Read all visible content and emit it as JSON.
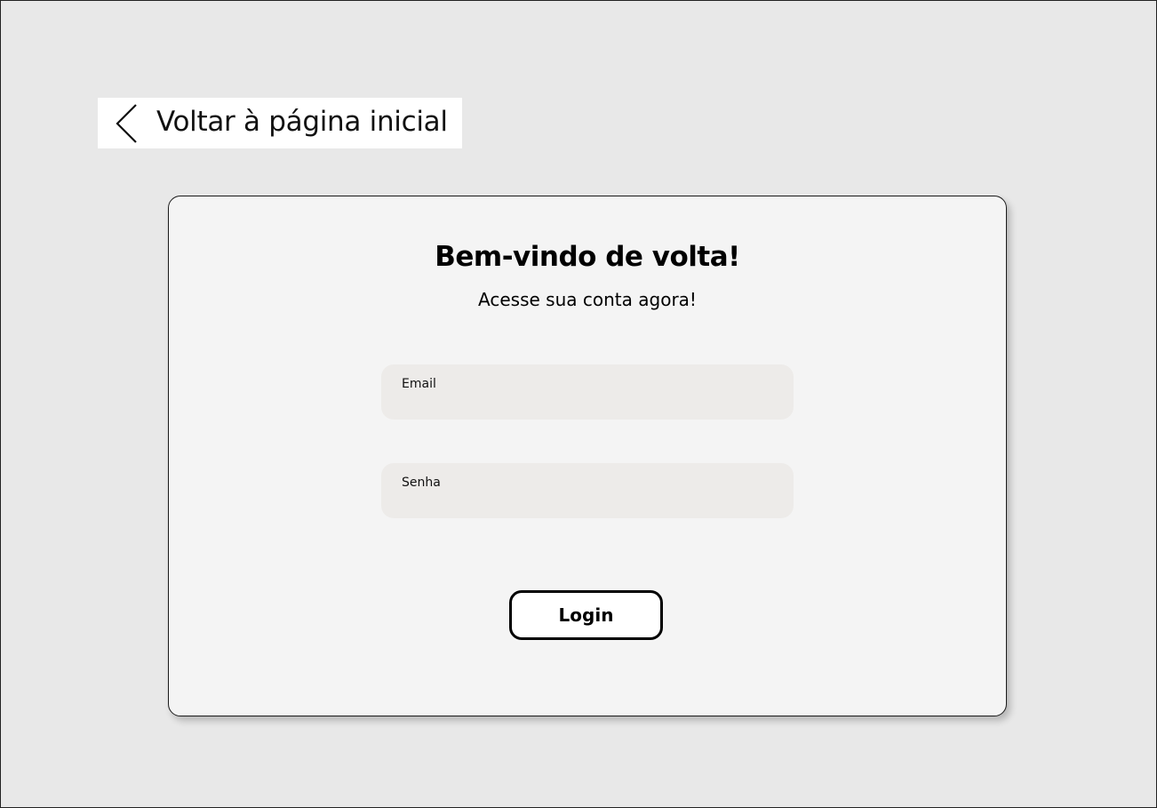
{
  "back_link": {
    "label": "Voltar à página inicial",
    "icon": "chevron-left-icon"
  },
  "login_card": {
    "title": "Bem-vindo de volta!",
    "subtitle": "Acesse sua conta agora!",
    "fields": {
      "email": {
        "label": "Email",
        "value": ""
      },
      "password": {
        "label": "Senha",
        "value": ""
      }
    },
    "login_button_label": "Login"
  },
  "colors": {
    "page_background": "#e8e8e8",
    "card_background": "#f4f4f4",
    "field_background": "#edebe9",
    "text": "#000000"
  }
}
